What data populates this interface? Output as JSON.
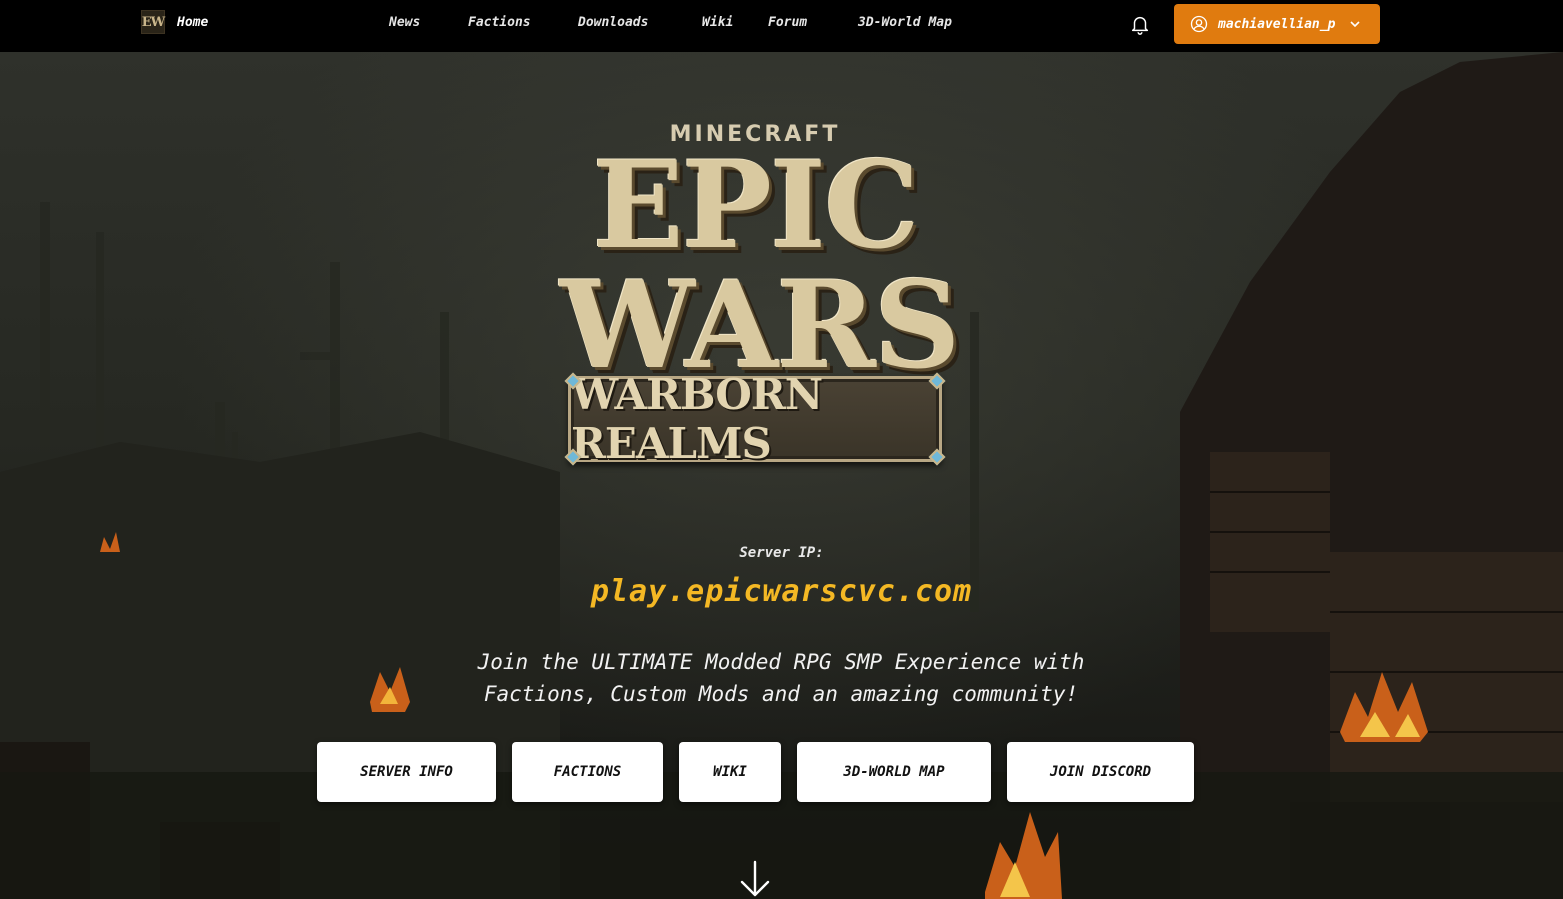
{
  "nav": {
    "brand_logo": "EW",
    "home_label": "Home",
    "links": [
      "News",
      "Factions",
      "Downloads",
      "Wiki",
      "Forum",
      "3D-World Map"
    ],
    "user_name": "machiavellian_p",
    "accent_color": "#e07b0f"
  },
  "hero": {
    "logo_top": "MINECRAFT",
    "logo_line1": "EPIC",
    "logo_line2": "WARS",
    "logo_banner": "WARBORN REALMS",
    "server_ip_label": "Server IP:",
    "server_ip": "play.epicwarscvc.com",
    "tagline_line1": "Join the ULTIMATE Modded RPG SMP Experience with",
    "tagline_line2": "Factions, Custom Mods and an amazing community!",
    "ip_color": "#f4b824"
  },
  "actions": [
    "SERVER INFO",
    "FACTIONS",
    "WIKI",
    "3D-WORLD MAP",
    "JOIN DISCORD"
  ],
  "icons": {
    "bell": "bell-icon",
    "user": "user-circle-icon",
    "chevron": "chevron-down-icon",
    "scroll": "arrow-down-icon"
  }
}
